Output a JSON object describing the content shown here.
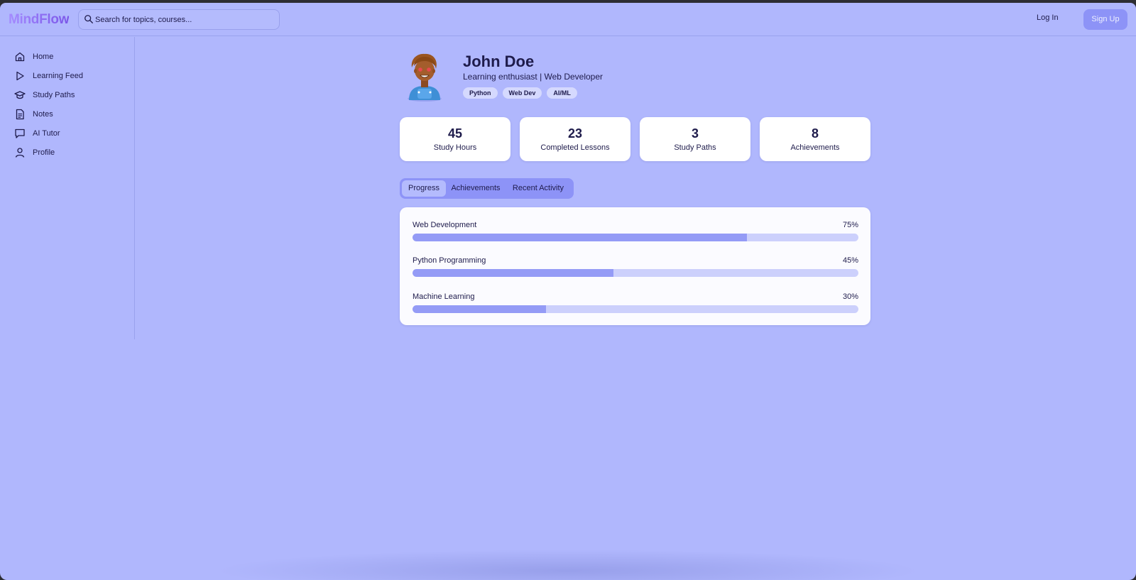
{
  "app": {
    "logo": "MindFlow",
    "accent": "#8d93f7",
    "background": "#b0b7fd"
  },
  "header": {
    "search": {
      "placeholder": "Search for topics, courses...",
      "value": "",
      "icon": "search-icon"
    },
    "login_label": "Log In",
    "signup_label": "Sign Up"
  },
  "sidebar": {
    "items": [
      {
        "label": "Home",
        "icon": "home-icon"
      },
      {
        "label": "Learning Feed",
        "icon": "play-icon"
      },
      {
        "label": "Study Paths",
        "icon": "graduation-cap-icon"
      },
      {
        "label": "Notes",
        "icon": "document-icon"
      },
      {
        "label": "AI Tutor",
        "icon": "chat-bubble-icon"
      },
      {
        "label": "Profile",
        "icon": "user-icon"
      }
    ]
  },
  "profile": {
    "name": "John Doe",
    "bio": "Learning enthusiast | Web Developer",
    "tags": [
      "Python",
      "Web Dev",
      "AI/ML"
    ]
  },
  "stats": [
    {
      "value": "45",
      "label": "Study Hours"
    },
    {
      "value": "23",
      "label": "Completed Lessons"
    },
    {
      "value": "3",
      "label": "Study Paths"
    },
    {
      "value": "8",
      "label": "Achievements"
    }
  ],
  "tabs": {
    "active": "Progress",
    "items": [
      "Progress",
      "Achievements",
      "Recent Activity"
    ]
  },
  "progress": [
    {
      "label": "Web Development",
      "percent_label": "75%",
      "percent": 75
    },
    {
      "label": "Python Programming",
      "percent_label": "45%",
      "percent": 45
    },
    {
      "label": "Machine Learning",
      "percent_label": "30%",
      "percent": 30
    }
  ]
}
